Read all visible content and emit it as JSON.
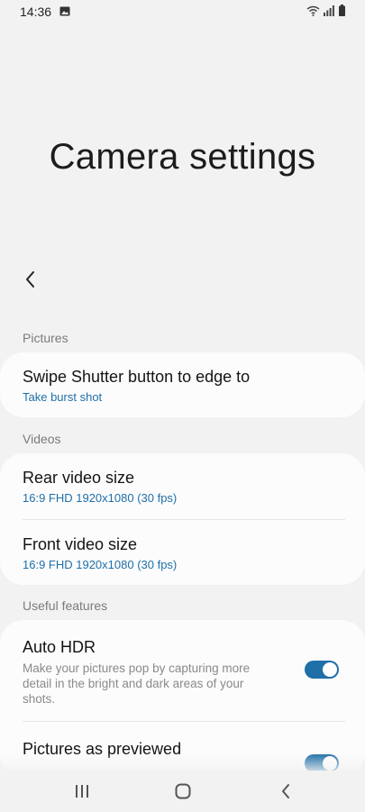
{
  "status_bar": {
    "time": "14:36",
    "icons": [
      "gallery-icon",
      "wifi-icon",
      "signal-icon",
      "battery-icon"
    ]
  },
  "header": {
    "title": "Camera settings",
    "back_icon": "chevron-left-icon"
  },
  "sections": {
    "pictures": {
      "label": "Pictures",
      "items": [
        {
          "title": "Swipe Shutter button to edge to",
          "value": "Take burst shot"
        }
      ]
    },
    "videos": {
      "label": "Videos",
      "items": [
        {
          "title": "Rear video size",
          "value": "16:9 FHD 1920x1080 (30 fps)"
        },
        {
          "title": "Front video size",
          "value": "16:9 FHD 1920x1080 (30 fps)"
        }
      ]
    },
    "useful_features": {
      "label": "Useful features",
      "items": [
        {
          "title": "Auto HDR",
          "description": "Make your pictures pop by capturing more detail in the bright and dark areas of your shots.",
          "toggle_on": true
        },
        {
          "title": "Pictures as previewed",
          "toggle_on": true
        }
      ]
    }
  },
  "nav_bar": {
    "icons": [
      "recents-icon",
      "home-icon",
      "back-icon"
    ]
  },
  "colors": {
    "background": "#f2f2f2",
    "card": "#fcfcfc",
    "accent": "#1f6fa8",
    "section_header": "#7b7b7b"
  }
}
